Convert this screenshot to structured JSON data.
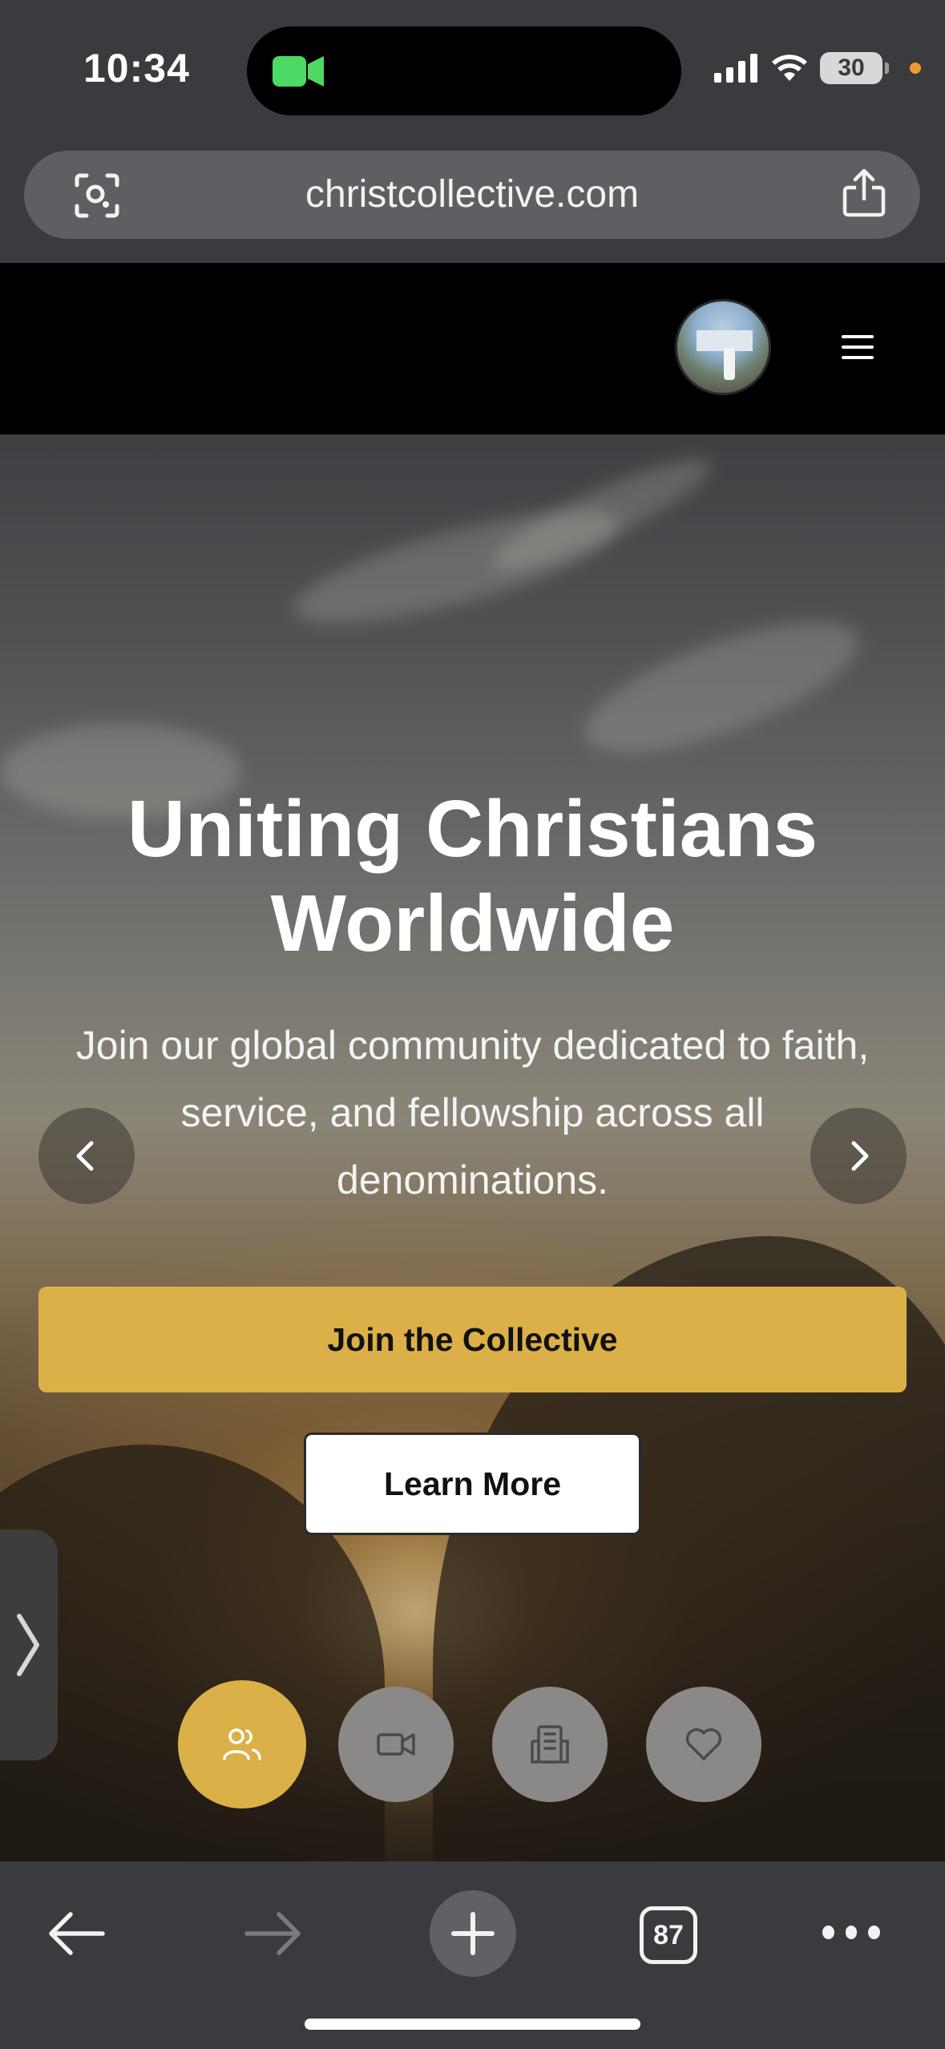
{
  "status_bar": {
    "time": "10:34",
    "battery": "30",
    "icons": [
      "camera-active-icon",
      "cellular-signal-icon",
      "wifi-icon",
      "battery-icon"
    ]
  },
  "browser": {
    "url": "christcollective.com",
    "tab_count": "87",
    "icons": [
      "visual-lookup-icon",
      "share-icon",
      "back-arrow-icon",
      "forward-arrow-icon",
      "new-tab-icon",
      "more-icon"
    ]
  },
  "site_header": {
    "icons": [
      "avatar",
      "hamburger-menu-icon"
    ]
  },
  "hero": {
    "title": "Uniting Christians Worldwide",
    "subtitle": "Join our global community dedicated to faith, service, and fellowship across all denominations.",
    "primary_cta": "Join the Collective",
    "secondary_cta": "Learn More",
    "accent_color": "#dcb048"
  },
  "feature_buttons": [
    {
      "icon": "users-icon",
      "active": true
    },
    {
      "icon": "video-camera-icon",
      "active": false
    },
    {
      "icon": "building-icon",
      "active": false
    },
    {
      "icon": "heart-icon",
      "active": false
    }
  ]
}
